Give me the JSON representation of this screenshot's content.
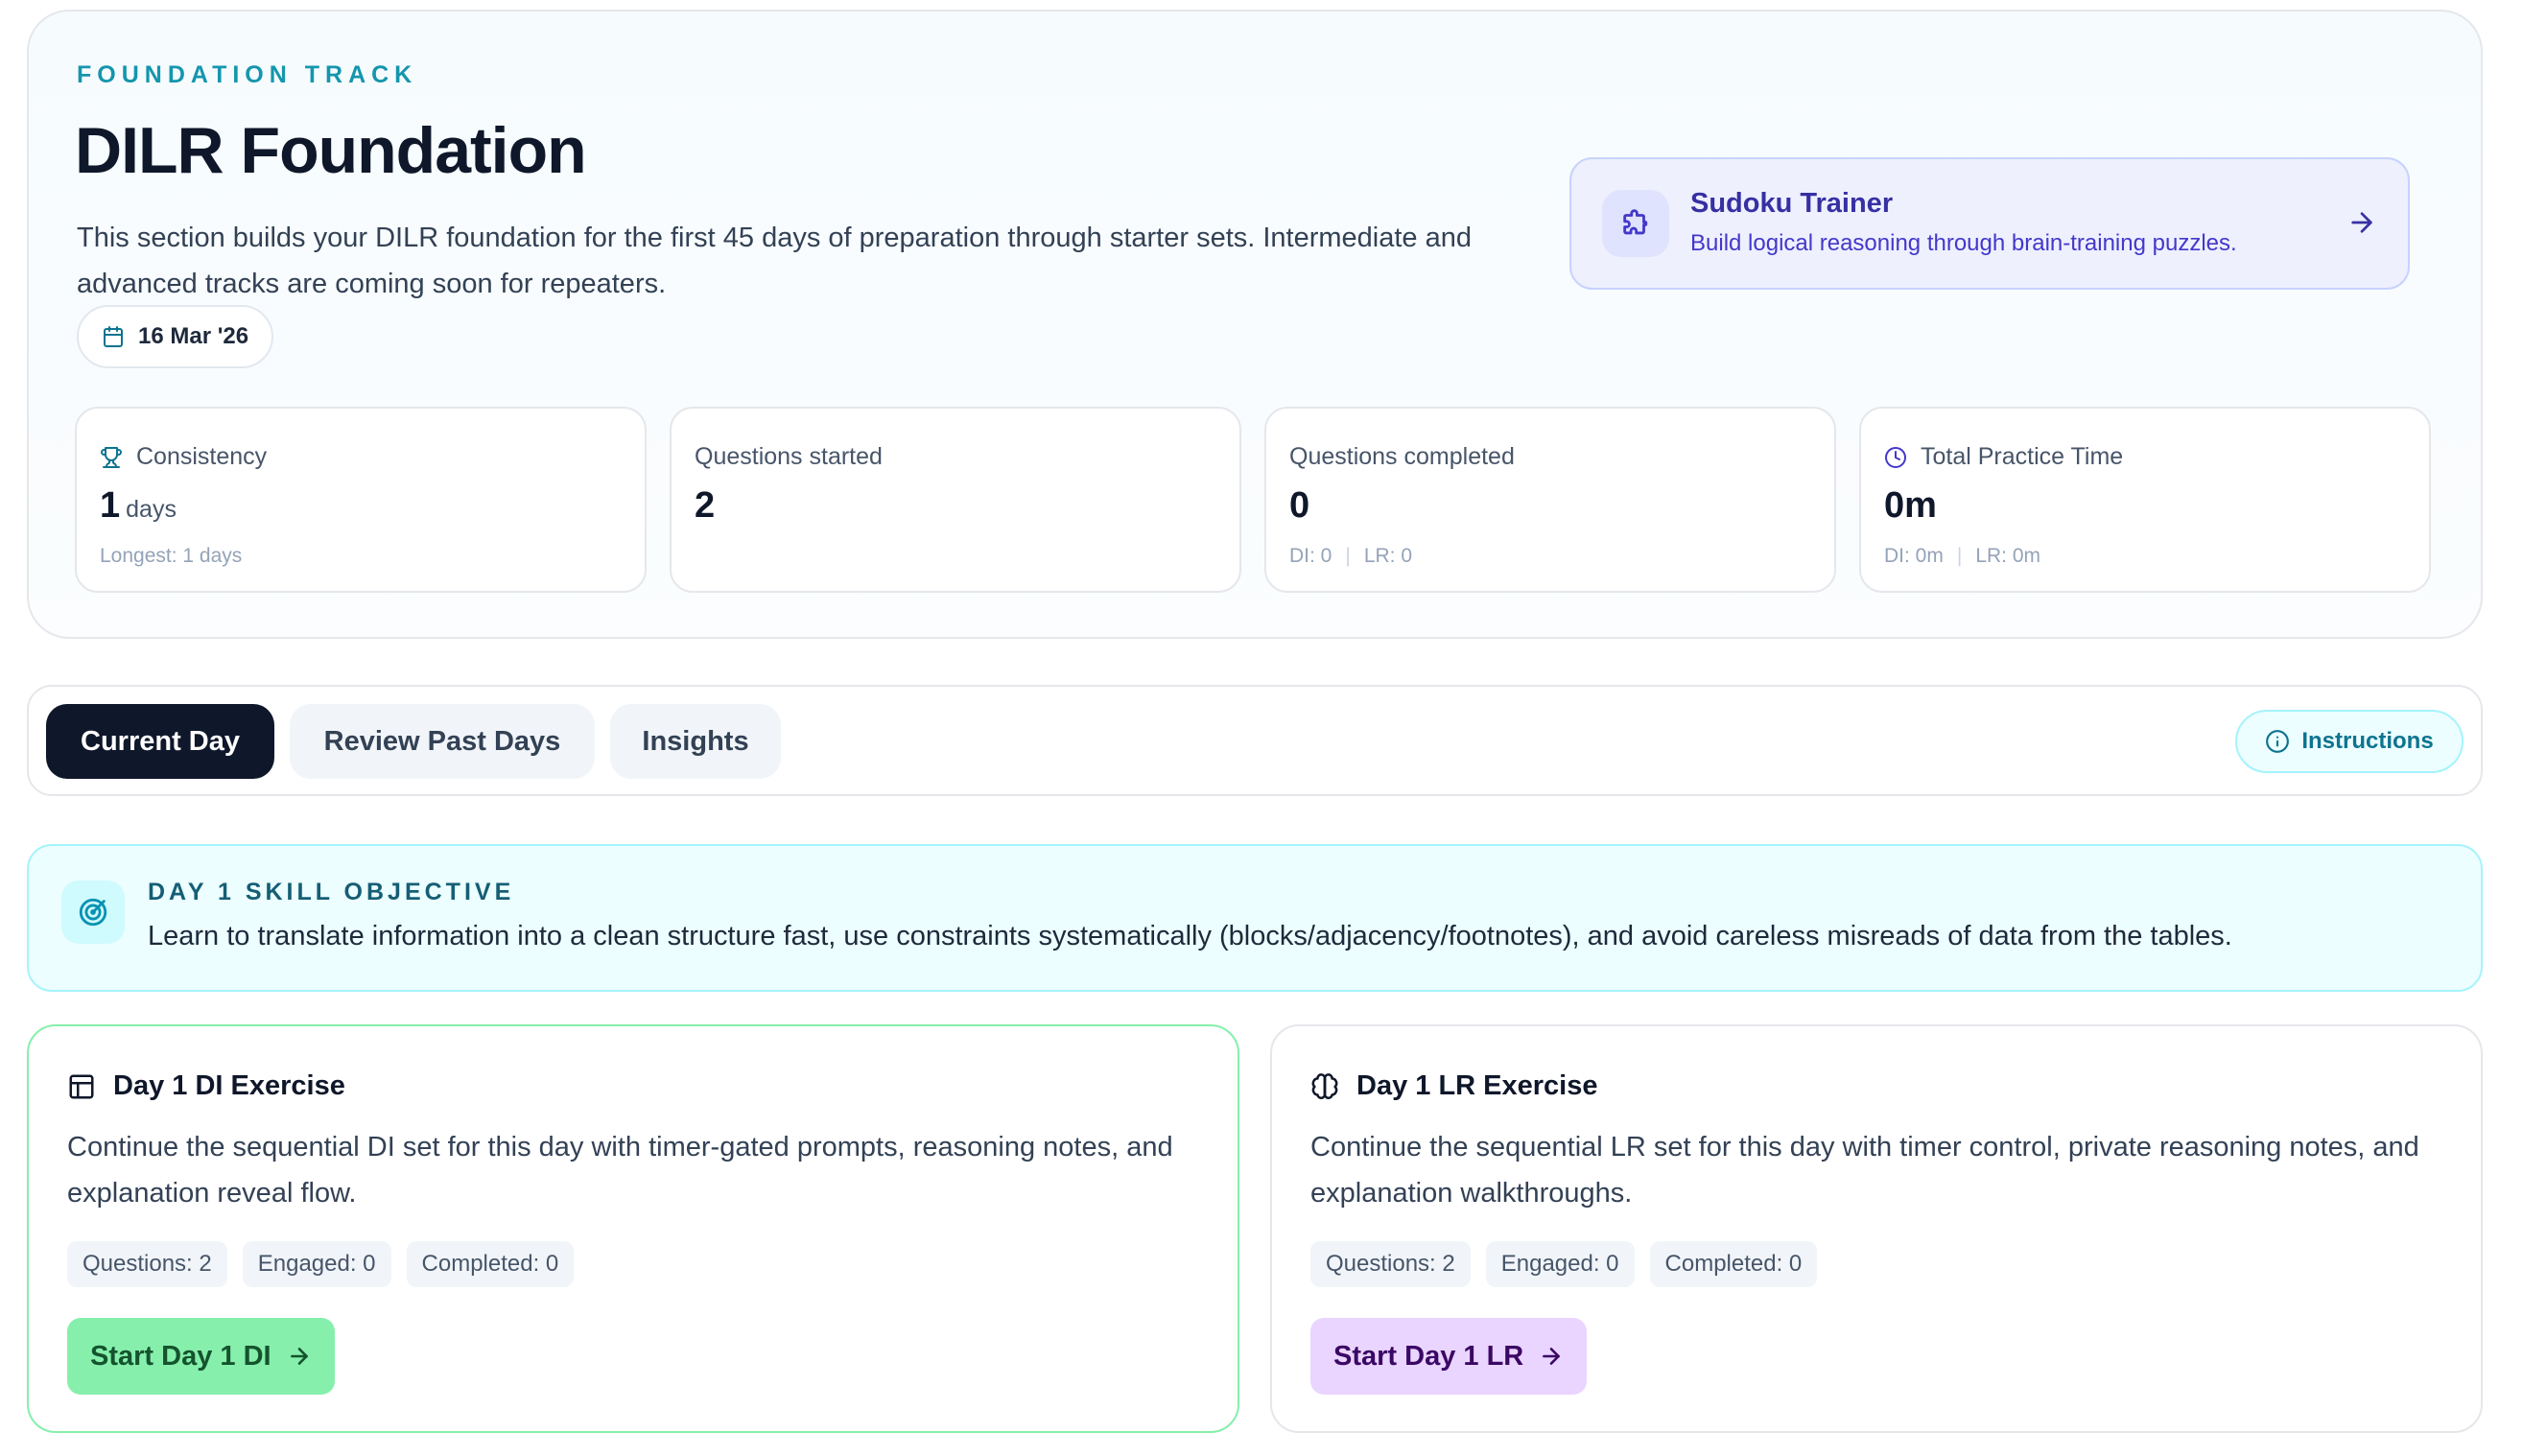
{
  "header": {
    "eyebrow": "FOUNDATION TRACK",
    "title": "DILR Foundation",
    "description": "This section builds your DILR foundation for the first 45 days of preparation through starter sets. Intermediate and advanced tracks are coming soon for repeaters.",
    "date": "16 Mar '26"
  },
  "sudoku": {
    "title": "Sudoku Trainer",
    "subtitle": "Build logical reasoning through brain-training puzzles."
  },
  "stats": {
    "consistency": {
      "label": "Consistency",
      "value": "1",
      "unit": "days",
      "sub": "Longest: 1 days"
    },
    "started": {
      "label": "Questions started",
      "value": "2"
    },
    "completed": {
      "label": "Questions completed",
      "value": "0",
      "di": "DI: 0",
      "lr": "LR: 0"
    },
    "time": {
      "label": "Total Practice Time",
      "value": "0m",
      "di": "DI: 0m",
      "lr": "LR: 0m"
    }
  },
  "tabs": {
    "current": "Current Day",
    "review": "Review Past Days",
    "insights": "Insights",
    "instructions": "Instructions"
  },
  "objective": {
    "eyebrow": "DAY 1 SKILL OBJECTIVE",
    "text": "Learn to translate information into a clean structure fast, use constraints systematically (blocks/adjacency/footnotes), and avoid careless misreads of data from the tables."
  },
  "exercises": {
    "di": {
      "title": "Day 1 DI Exercise",
      "description": "Continue the sequential DI set for this day with timer-gated prompts, reasoning notes, and explanation reveal flow.",
      "questions": "Questions: 2",
      "engaged": "Engaged: 0",
      "completed": "Completed: 0",
      "button": "Start Day 1 DI"
    },
    "lr": {
      "title": "Day 1 LR Exercise",
      "description": "Continue the sequential LR set for this day with timer control, private reasoning notes, and explanation walkthroughs.",
      "questions": "Questions: 2",
      "engaged": "Engaged: 0",
      "completed": "Completed: 0",
      "button": "Start Day 1 LR"
    }
  },
  "colors": {
    "accent_teal": "#1496ad",
    "dark": "#0f172a",
    "di_green": "#86efac",
    "lr_purple": "#e9d5ff",
    "indigo": "#3730a3"
  }
}
